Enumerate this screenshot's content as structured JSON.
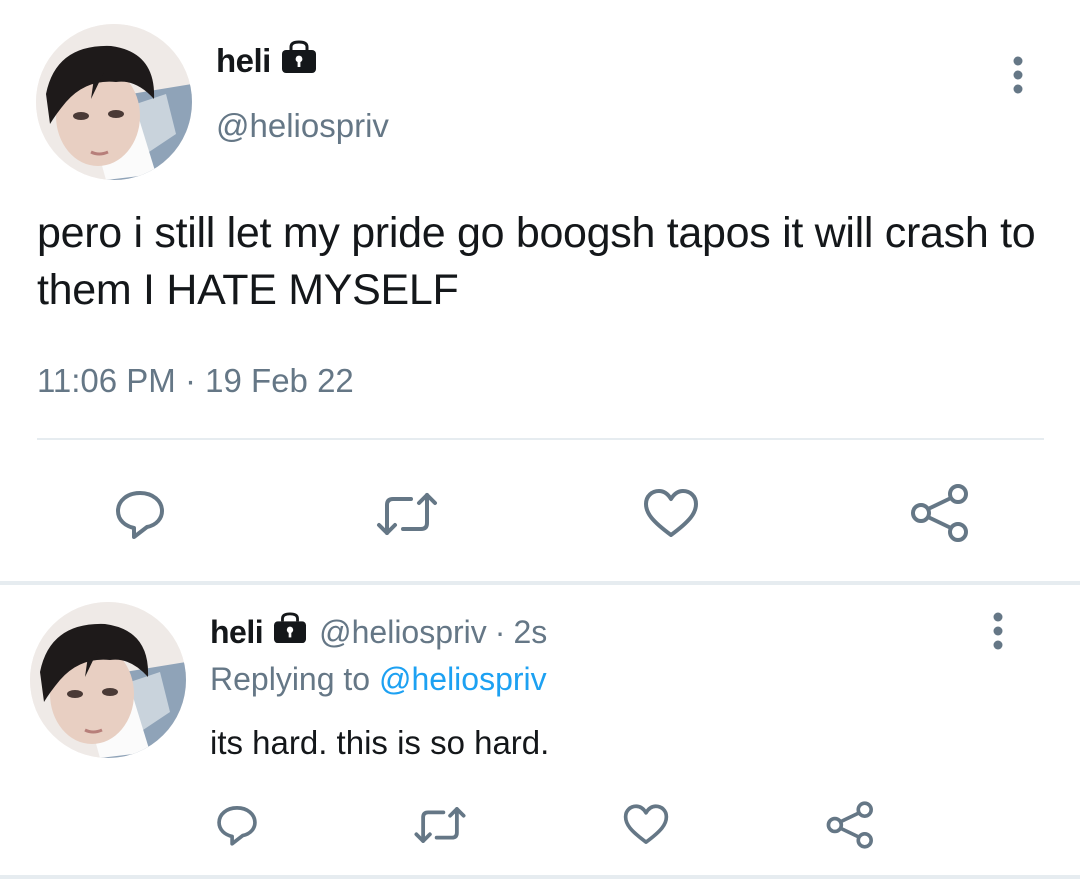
{
  "main_tweet": {
    "display_name": "heli",
    "handle": "@heliospriv",
    "text": "pero i still let my pride go boogsh tapos it will crash to them I HATE MYSELF",
    "time": "11:06 PM",
    "separator": "·",
    "date": "19 Feb 22",
    "protected_icon": "lock-icon",
    "actions": [
      "reply-icon",
      "retweet-icon",
      "like-icon",
      "share-icon"
    ]
  },
  "reply_tweet": {
    "display_name": "heli",
    "handle": "@heliospriv",
    "separator": "·",
    "time_ago": "2s",
    "replying_prefix": "Replying to",
    "replying_to": "@heliospriv",
    "text": "its hard. this is so hard.",
    "protected_icon": "lock-icon",
    "actions": [
      "reply-icon",
      "retweet-icon",
      "like-icon",
      "share-icon"
    ]
  },
  "colors": {
    "text_primary": "#14171a",
    "text_secondary": "#657786",
    "link": "#1da1f2",
    "icon": "#657786",
    "divider": "#e6ecf0"
  }
}
